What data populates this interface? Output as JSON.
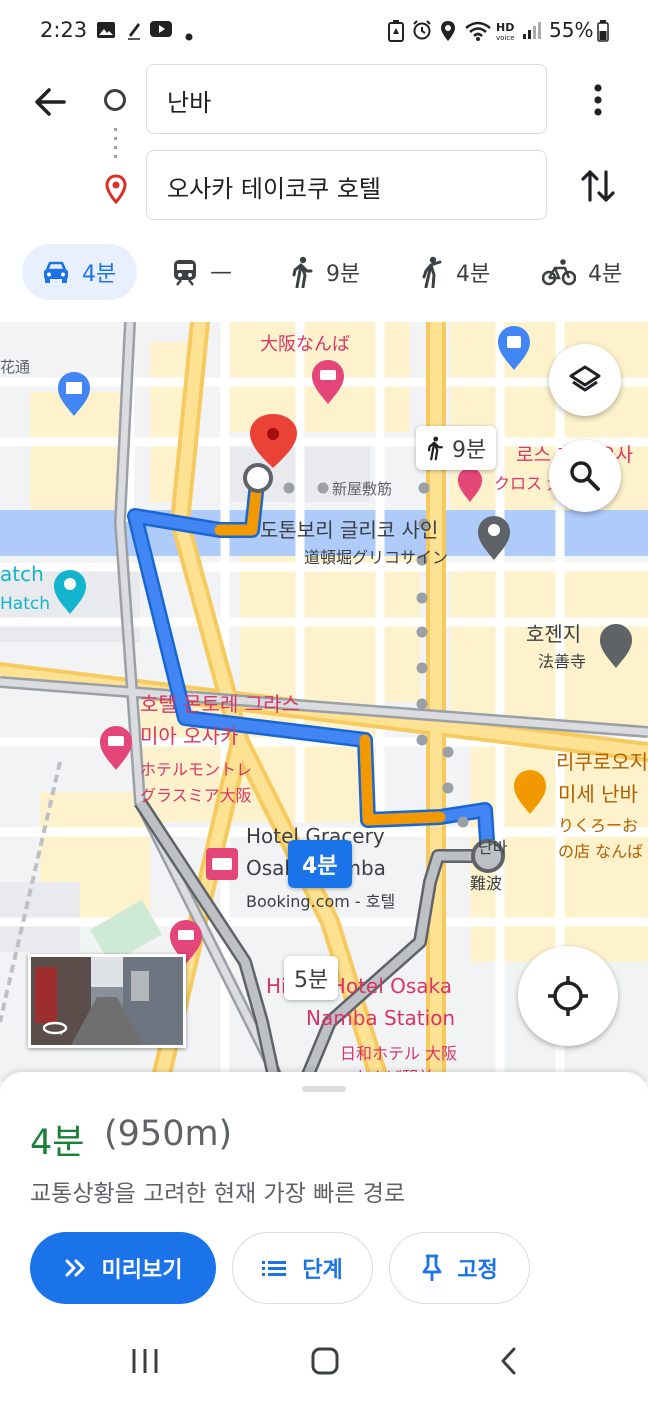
{
  "status_bar": {
    "time": "2:23",
    "battery_percent": "55%",
    "left_icons": [
      "image-icon",
      "pen-icon",
      "youtube-icon",
      "dot-icon"
    ],
    "right_icons": [
      "battery-saver-icon",
      "alarm-icon",
      "location-icon",
      "wifi-icon",
      "hd-voice-icon",
      "signal-icon",
      "battery-icon"
    ]
  },
  "route": {
    "origin": "난바",
    "destination": "오사카 테이코쿠 호텔"
  },
  "modes": [
    {
      "id": "drive",
      "icon": "car-icon",
      "label": "4분",
      "active": true
    },
    {
      "id": "transit",
      "icon": "train-icon",
      "label": "—",
      "active": false
    },
    {
      "id": "walk",
      "icon": "walk-icon",
      "label": "9분",
      "active": false
    },
    {
      "id": "ride",
      "icon": "ride-hail-icon",
      "label": "4분",
      "active": false
    },
    {
      "id": "bike",
      "icon": "bike-icon",
      "label": "4분",
      "active": false
    }
  ],
  "map": {
    "labels": {
      "osaka_namba": "大阪なんば",
      "hanamichi": "花通",
      "shinyashiki": "新屋敷筋",
      "glico_ko": "도톤보리 글리코 사인",
      "glico_ja": "道頓堀グリコサイン",
      "watch_1": "atch",
      "watch_2": "Hatch",
      "hozenji_ko": "호젠지",
      "hozenji_ja": "法善寺",
      "monterey_ko_1": "호텔 몬토레 그라스",
      "monterey_ko_2": "미아 오사카",
      "monterey_ja_1": "ホテルモントレ",
      "monterey_ja_2": "グラスミア大阪",
      "rikuro_ko_1": "리쿠로오지",
      "rikuro_ko_2": "미세 난바",
      "rikuro_ja_1": "りくろーお",
      "rikuro_ja_2": "の店 なんば",
      "cross_ko": "로스 호텔 오사",
      "cross_ja": "クロス 大阪",
      "gracery_1": "Hotel Gracery",
      "gracery_2": "Osaka Namba",
      "booking": "Booking.com - 호텔",
      "namba_ko": "난바",
      "namba_ja": "難波",
      "hiyori_en_1": "Hiyori Hotel Osaka",
      "hiyori_en_2": "Namba Station",
      "hiyori_ja_1": "日和ホテル 大阪",
      "hiyori_ja_2": "なんば駅前"
    },
    "walk_chip": "9분",
    "drive_chip": "4분",
    "alt_chip": "5분",
    "colors": {
      "route_fast": "#4285f4",
      "route_slow": "#f29900",
      "route_alt": "#9aa0a6",
      "destination_pin": "#ea4335",
      "poi_pink": "#e5467a"
    }
  },
  "sheet": {
    "time": "4분",
    "distance": "(950m)",
    "description": "교통상황을 고려한 현재 가장 빠른 경로",
    "buttons": {
      "preview": "미리보기",
      "steps": "단계",
      "pin": "고정"
    }
  }
}
